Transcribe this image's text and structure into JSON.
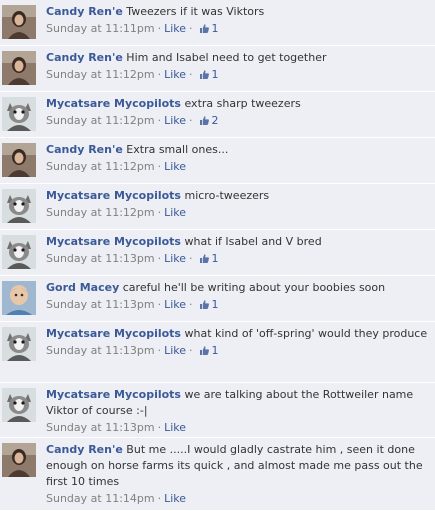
{
  "comments": [
    {
      "author": "Candy Ren'e",
      "avatar": "candy-avatar",
      "text": "Tweezers if it was Viktors",
      "time": "Sunday at 11:11pm",
      "like_label": "Like",
      "likes": "1"
    },
    {
      "author": "Candy Ren'e",
      "avatar": "candy-avatar",
      "text": "Him and Isabel need to get together",
      "time": "Sunday at 11:12pm",
      "like_label": "Like",
      "likes": "1"
    },
    {
      "author": "Mycatsare Mycopilots",
      "avatar": "cat-avatar",
      "text": "extra sharp tweezers",
      "time": "Sunday at 11:12pm",
      "like_label": "Like",
      "likes": "2"
    },
    {
      "author": "Candy Ren'e",
      "avatar": "candy-avatar",
      "text": "Extra small ones...",
      "time": "Sunday at 11:12pm",
      "like_label": "Like",
      "likes": null
    },
    {
      "author": "Mycatsare Mycopilots",
      "avatar": "cat-avatar",
      "text": "micro-tweezers",
      "time": "Sunday at 11:12pm",
      "like_label": "Like",
      "likes": null
    },
    {
      "author": "Mycatsare Mycopilots",
      "avatar": "cat-avatar",
      "text": "what if Isabel and V bred",
      "time": "Sunday at 11:13pm",
      "like_label": "Like",
      "likes": "1"
    },
    {
      "author": "Gord Macey",
      "avatar": "gord-avatar",
      "text": "careful he'll be writing about your boobies soon",
      "time": "Sunday at 11:13pm",
      "like_label": "Like",
      "likes": "1"
    },
    {
      "author": "Mycatsare Mycopilots",
      "avatar": "cat-avatar",
      "text": "what kind of 'off-spring' would they produce",
      "time": "Sunday at 11:13pm",
      "like_label": "Like",
      "likes": "1"
    },
    {
      "author": "Mycatsare Mycopilots",
      "avatar": "cat-avatar",
      "text": "we are talking about the Rottweiler name Viktor of course :-|",
      "time": "Sunday at 11:13pm",
      "like_label": "Like",
      "likes": null
    },
    {
      "author": "Candy Ren'e",
      "avatar": "candy-avatar",
      "text": "But me .....I would gladly castrate him , seen it done enough on horse farms its quick , and almost made me pass out the first 10 times",
      "time": "Sunday at 11:14pm",
      "like_label": "Like",
      "likes": null
    }
  ],
  "colors": {
    "background": "#edeff4",
    "link": "#3b5998",
    "meta": "#808080",
    "text": "#333333"
  }
}
